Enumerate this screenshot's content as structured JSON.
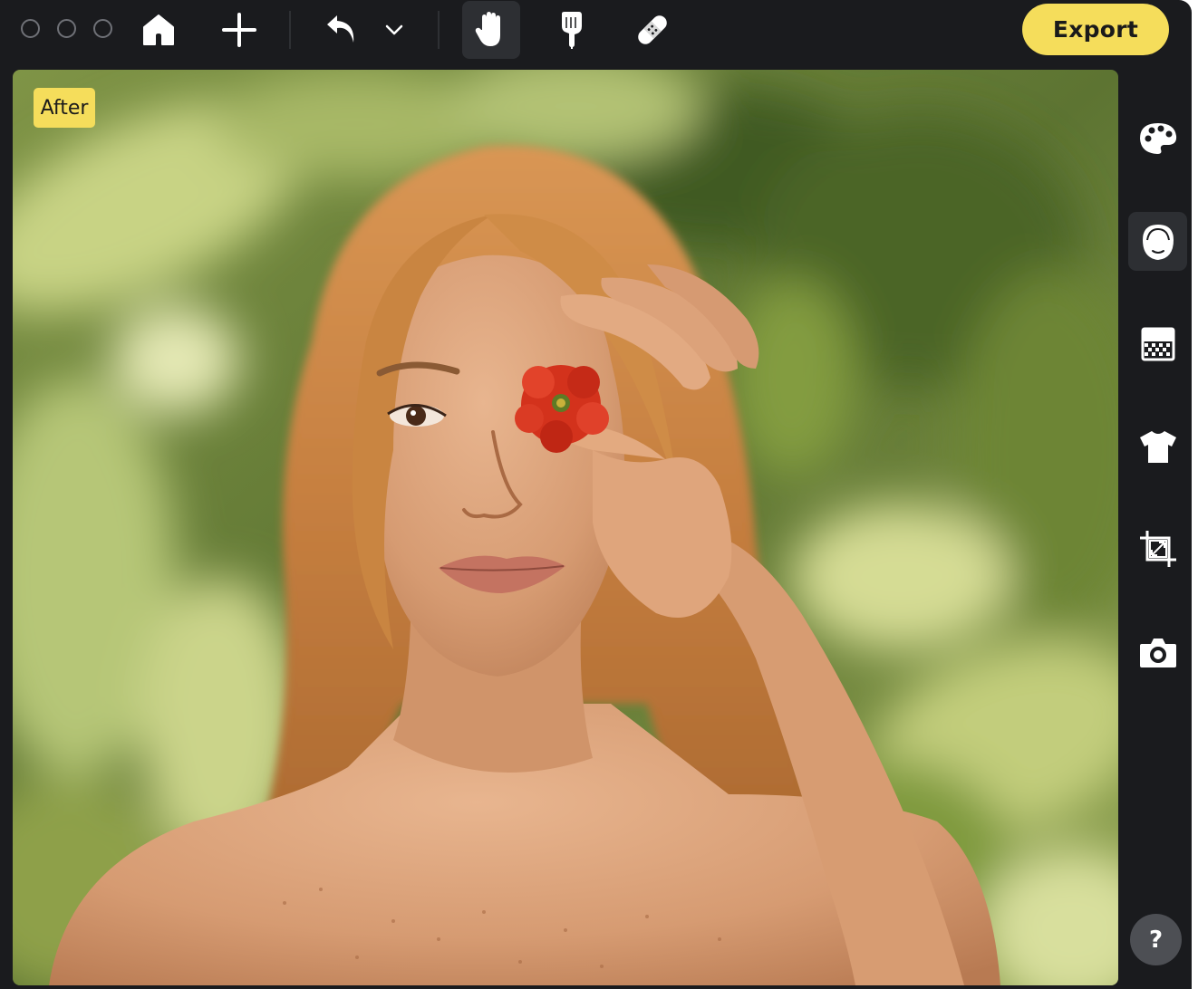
{
  "toolbar": {
    "window_controls": [
      "close",
      "minimize",
      "zoom"
    ],
    "tools": [
      {
        "icon": "home-icon"
      },
      {
        "icon": "plus-icon"
      },
      {
        "icon": "undo-icon"
      },
      {
        "icon": "chevron-down-icon"
      },
      {
        "icon": "hand-icon",
        "active": true
      },
      {
        "icon": "finger-tap-icon"
      },
      {
        "icon": "bandage-icon"
      }
    ],
    "export_label": "Export"
  },
  "canvas": {
    "badge": "After"
  },
  "sidebar": {
    "items": [
      {
        "icon": "palette-icon"
      },
      {
        "icon": "face-icon",
        "active": true
      },
      {
        "icon": "background-icon"
      },
      {
        "icon": "shirt-icon"
      },
      {
        "icon": "crop-icon"
      },
      {
        "icon": "camera-icon"
      }
    ],
    "help_label": "?"
  },
  "colors": {
    "accent": "#f5dd5b",
    "app_bg": "#1a1b1e",
    "active_bg": "#2d2f33",
    "icon": "#ffffff"
  }
}
